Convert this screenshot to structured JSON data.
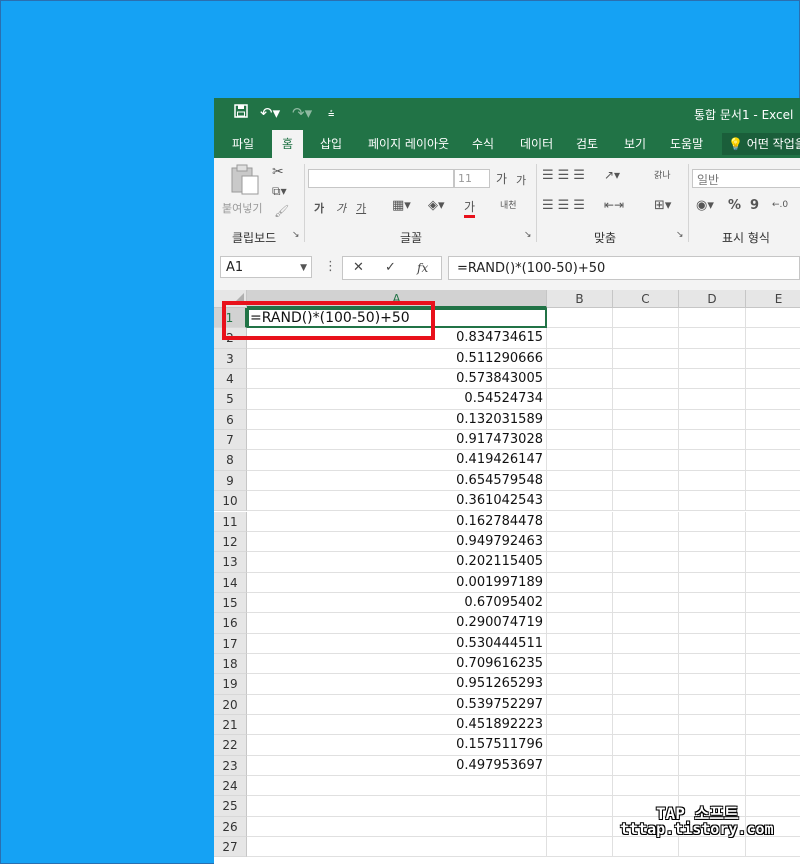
{
  "window": {
    "title": "통합 문서1  -  Excel"
  },
  "quick_access": {
    "save_icon": "save-icon",
    "undo_icon": "undo-icon",
    "redo_icon": "redo-icon",
    "customize_icon": "customize-icon"
  },
  "menu": {
    "tabs": [
      "파일",
      "홈",
      "삽입",
      "페이지 레이아웃",
      "수식",
      "데이터",
      "검토",
      "보기",
      "도움말"
    ],
    "active_tab": "홈",
    "tell_me": "어떤 작업을"
  },
  "ribbon": {
    "clipboard": {
      "label": "클립보드",
      "paste": "붙여넣기"
    },
    "font": {
      "label": "글꼴",
      "size": "11",
      "bold": "가",
      "italic": "가",
      "underline": "가",
      "grow": "가",
      "shrink": "가",
      "color": "가",
      "phonetic": "내천"
    },
    "alignment": {
      "label": "맞춤",
      "wrap": "갉나"
    },
    "number": {
      "label": "표시 형식",
      "format": "일반",
      "percent": "%",
      "comma": "9"
    }
  },
  "formula_bar": {
    "name_box": "A1",
    "formula": "=RAND()*(100-50)+50",
    "cancel": "✕",
    "enter": "✓",
    "fx": "fx"
  },
  "columns": [
    "A",
    "B",
    "C",
    "D",
    "E"
  ],
  "rows": [
    "1",
    "2",
    "3",
    "4",
    "5",
    "6",
    "7",
    "8",
    "9",
    "10",
    "11",
    "12",
    "13",
    "14",
    "15",
    "16",
    "17",
    "18",
    "19",
    "20",
    "21",
    "22",
    "23",
    "24",
    "25",
    "26",
    "27"
  ],
  "cells": {
    "a1": "=RAND()*(100-50)+50",
    "a_values": [
      "0.834734615",
      "0.511290666",
      "0.573843005",
      "0.54524734",
      "0.132031589",
      "0.917473028",
      "0.419426147",
      "0.654579548",
      "0.361042543",
      "0.162784478",
      "0.949792463",
      "0.202115405",
      "0.001997189",
      "0.67095402",
      "0.290074719",
      "0.530444511",
      "0.709616235",
      "0.951265293",
      "0.539752297",
      "0.451892223",
      "0.157511796",
      "0.497953697"
    ]
  },
  "watermark": {
    "line1": "TAP 소프트",
    "line2": "tttap.tistory.com"
  },
  "colors": {
    "excel_green": "#217346",
    "highlight_red": "#e8111b",
    "desktop_blue": "#15a2f4"
  }
}
